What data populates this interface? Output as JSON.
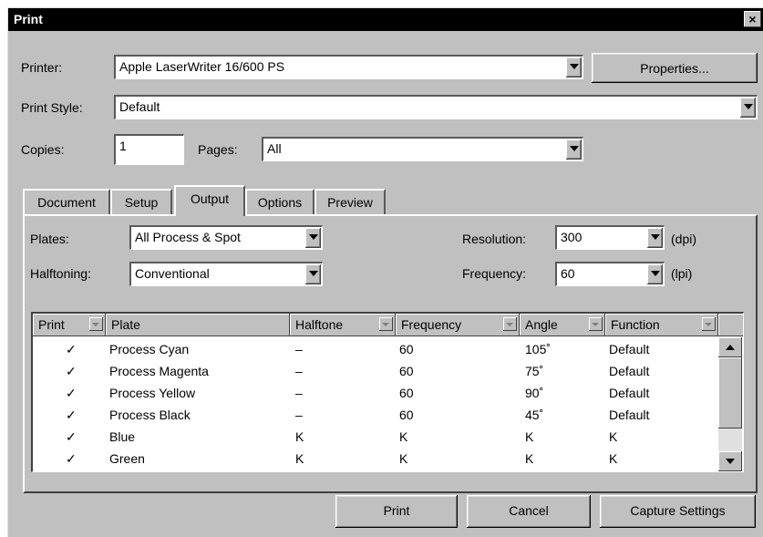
{
  "window": {
    "title": "Print",
    "close": "×"
  },
  "printer": {
    "label": "Printer:",
    "value": "Apple LaserWriter 16/600 PS",
    "properties_button": "Properties..."
  },
  "print_style": {
    "label": "Print Style:",
    "value": "Default"
  },
  "copies": {
    "label": "Copies:",
    "value": "1"
  },
  "pages": {
    "label": "Pages:",
    "value": "All"
  },
  "tabs": [
    {
      "label": "Document",
      "active": false
    },
    {
      "label": "Setup",
      "active": false
    },
    {
      "label": "Output",
      "active": true
    },
    {
      "label": "Options",
      "active": false
    },
    {
      "label": "Preview",
      "active": false
    }
  ],
  "output": {
    "plates": {
      "label": "Plates:",
      "value": "All Process & Spot"
    },
    "halftoning": {
      "label": "Halftoning:",
      "value": "Conventional"
    },
    "resolution": {
      "label": "Resolution:",
      "value": "300",
      "unit": "(dpi)"
    },
    "frequency": {
      "label": "Frequency:",
      "value": "60",
      "unit": "(lpi)"
    }
  },
  "table": {
    "columns": [
      "Print",
      "Plate",
      "Halftone",
      "Frequency",
      "Angle",
      "Function"
    ],
    "rows": [
      {
        "print": "✓",
        "plate": "Process Cyan",
        "halftone": "–",
        "frequency": "60",
        "angle": "105˚",
        "function": "Default"
      },
      {
        "print": "✓",
        "plate": "Process Magenta",
        "halftone": "–",
        "frequency": "60",
        "angle": "75˚",
        "function": "Default"
      },
      {
        "print": "✓",
        "plate": "Process Yellow",
        "halftone": "–",
        "frequency": "60",
        "angle": "90˚",
        "function": "Default"
      },
      {
        "print": "✓",
        "plate": "Process Black",
        "halftone": "–",
        "frequency": "60",
        "angle": "45˚",
        "function": "Default"
      },
      {
        "print": "✓",
        "plate": "Blue",
        "halftone": "K",
        "frequency": "K",
        "angle": "K",
        "function": "K"
      },
      {
        "print": "✓",
        "plate": "Green",
        "halftone": "K",
        "frequency": "K",
        "angle": "K",
        "function": "K"
      }
    ]
  },
  "buttons": {
    "print": "Print",
    "cancel": "Cancel",
    "capture": "Capture Settings"
  }
}
